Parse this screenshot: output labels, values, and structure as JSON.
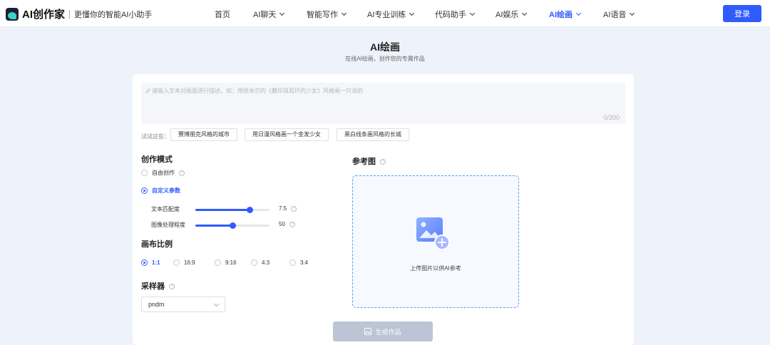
{
  "header": {
    "brand": "AI创作家",
    "slogan": "更懂你的智能AI小助手",
    "nav": [
      {
        "label": "首页",
        "dropdown": false,
        "active": false
      },
      {
        "label": "AI聊天",
        "dropdown": true,
        "active": false
      },
      {
        "label": "智能写作",
        "dropdown": true,
        "active": false
      },
      {
        "label": "AI专业训练",
        "dropdown": true,
        "active": false
      },
      {
        "label": "代码助手",
        "dropdown": true,
        "active": false
      },
      {
        "label": "AI娱乐",
        "dropdown": true,
        "active": false
      },
      {
        "label": "AI绘画",
        "dropdown": true,
        "active": true
      },
      {
        "label": "AI语音",
        "dropdown": true,
        "active": false
      }
    ],
    "login_label": "登录"
  },
  "page": {
    "title": "AI绘画",
    "subtitle": "在线AI绘画，创作您的专属作品"
  },
  "prompt": {
    "placeholder": "请输入文本对画面进行描述。如：用徐米尔的《戴珍珠耳环的少女》风格画一只海豹",
    "counter": "0/300"
  },
  "suggestions": {
    "label": "试试这些：",
    "items": [
      "赛博朋克风格的城市",
      "用日漫风格画一个金发少女",
      "黑白线条画风格的长城"
    ]
  },
  "mode": {
    "title": "创作模式",
    "options": [
      {
        "label": "自由创作",
        "selected": false
      },
      {
        "label": "自定义参数",
        "selected": true
      }
    ],
    "sliders": [
      {
        "label": "文本匹配度",
        "value": "7.5",
        "fraction": 0.73
      },
      {
        "label": "图像处理程度",
        "value": "50",
        "fraction": 0.5
      }
    ]
  },
  "ratio": {
    "title": "画布比例",
    "options": [
      {
        "label": "1:1",
        "selected": true
      },
      {
        "label": "16:9",
        "selected": false
      },
      {
        "label": "9:16",
        "selected": false
      },
      {
        "label": "4:3",
        "selected": false
      },
      {
        "label": "3:4",
        "selected": false
      }
    ]
  },
  "sampler": {
    "title": "采样器",
    "value": "pndm"
  },
  "reference": {
    "title": "参考图",
    "upload_text": "上传图片以供AI参考"
  },
  "generate_label": "生成作品",
  "colors": {
    "accent": "#2e5bff",
    "upload_border": "#5aa0e8",
    "disabled_button": "#bcc4d6"
  },
  "icons": {
    "help": "question-circle-icon",
    "upload": "image-add-icon",
    "generate": "image-icon",
    "prompt": "pencil-icon"
  }
}
